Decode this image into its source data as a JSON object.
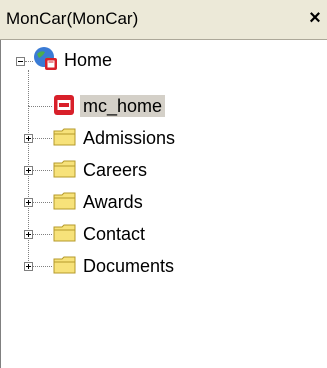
{
  "panel": {
    "title": "MonCar(MonCar)",
    "close_label": "×"
  },
  "tree": {
    "root": {
      "label": "Home",
      "expanded": true
    },
    "children": [
      {
        "label": "mc_home",
        "type": "page",
        "selected": true
      },
      {
        "label": "Admissions",
        "type": "folder",
        "expanded": false
      },
      {
        "label": "Careers",
        "type": "folder",
        "expanded": false
      },
      {
        "label": "Awards",
        "type": "folder",
        "expanded": false
      },
      {
        "label": "Contact",
        "type": "folder",
        "expanded": false
      },
      {
        "label": "Documents",
        "type": "folder",
        "expanded": false
      }
    ]
  },
  "icons": {
    "root": "globe-home-icon",
    "page": "page-icon",
    "folder": "folder-icon"
  },
  "colors": {
    "titlebar_bg": "#ece9d8",
    "folder_fill": "#f7e27a",
    "page_red": "#d8202a",
    "selected_bg": "#d4d0c8"
  }
}
